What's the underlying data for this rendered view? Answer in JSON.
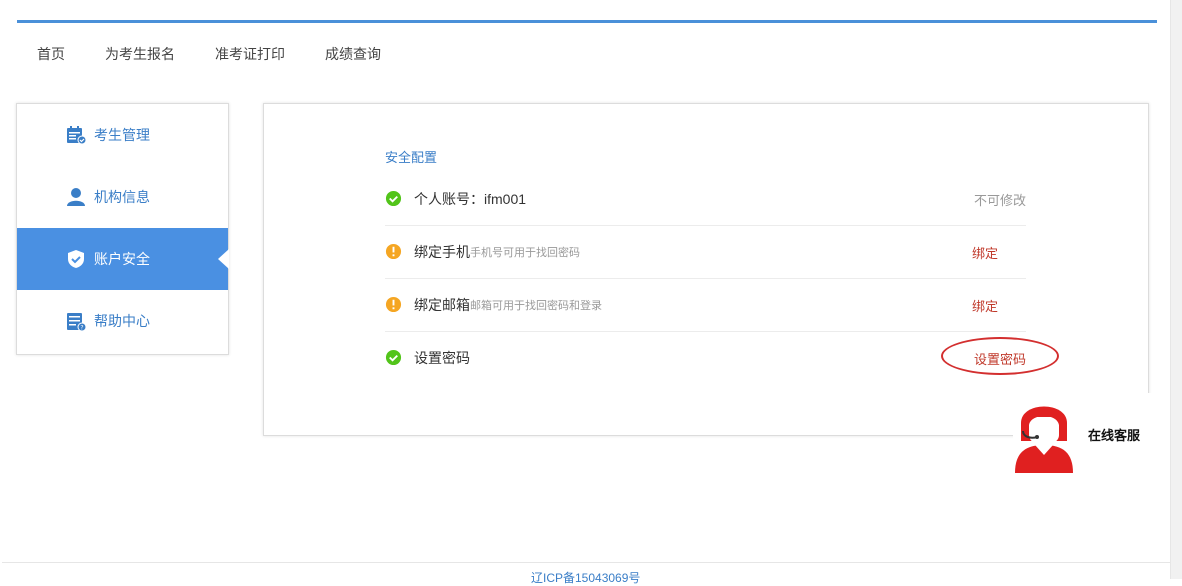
{
  "nav": {
    "items": [
      "首页",
      "为考生报名",
      "准考证打印",
      "成绩查询"
    ]
  },
  "sidebar": {
    "items": [
      {
        "label": "考生管理",
        "icon": "calendar-user-icon"
      },
      {
        "label": "机构信息",
        "icon": "user-icon"
      },
      {
        "label": "账户安全",
        "icon": "shield-check-icon",
        "active": true
      },
      {
        "label": "帮助中心",
        "icon": "help-doc-icon"
      }
    ]
  },
  "security": {
    "title": "安全配置",
    "rows": [
      {
        "label": "个人账号：ifm001",
        "hint": "",
        "status": "ok",
        "action": "不可修改"
      },
      {
        "label": "绑定手机",
        "hint": "手机号可用于找回密码",
        "status": "warn",
        "action": "绑定"
      },
      {
        "label": "绑定邮箱",
        "hint": "邮箱可用于找回密码和登录",
        "status": "warn",
        "action": "绑定"
      },
      {
        "label": "设置密码",
        "hint": "",
        "status": "ok",
        "action": "设置密码"
      }
    ]
  },
  "customer_service": {
    "label": "在线客服"
  },
  "footer": {
    "icp": "辽ICP备15043069号"
  },
  "colors": {
    "accent": "#4a90e2",
    "ok": "#52c41a",
    "warn": "#f5a623",
    "danger": "#c0392b"
  }
}
